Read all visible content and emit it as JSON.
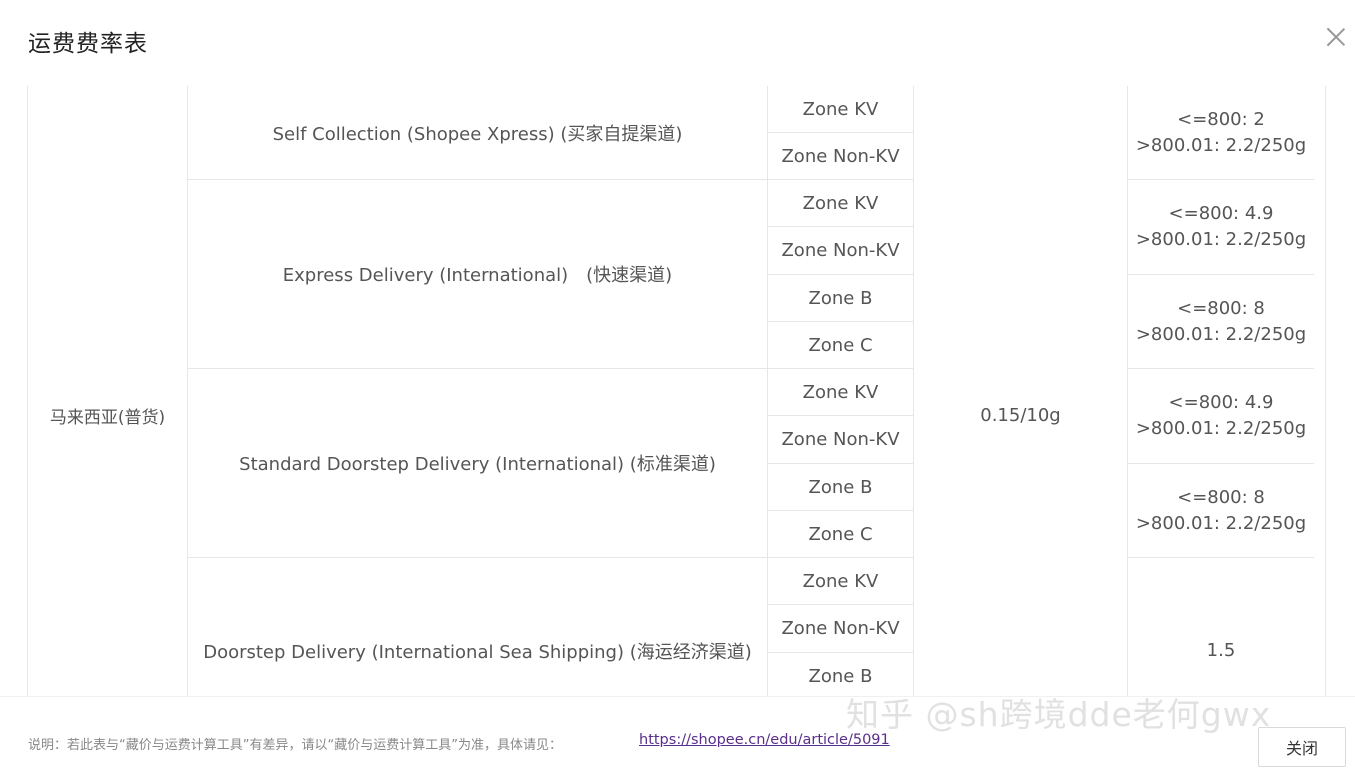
{
  "modal": {
    "title": "运费费率表",
    "close_icon": "close-icon"
  },
  "table": {
    "country": "马来西亚(普货)",
    "weight_rate": "0.15/10g",
    "channels": [
      {
        "name": "Self Collection (Shopee Xpress) (买家自提渠道)",
        "zones": [
          "Zone KV",
          "Zone Non-KV"
        ],
        "rates": [
          [
            "<=800: 2",
            ">800.01: 2.2/250g"
          ]
        ]
      },
      {
        "name": "Express Delivery (International)　(快速渠道)",
        "zones": [
          "Zone KV",
          "Zone Non-KV",
          "Zone B",
          "Zone C"
        ],
        "rates": [
          [
            "<=800: 4.9",
            ">800.01: 2.2/250g"
          ],
          [
            "<=800: 8",
            ">800.01: 2.2/250g"
          ]
        ]
      },
      {
        "name": "Standard Doorstep Delivery (International) (标准渠道)",
        "zones": [
          "Zone KV",
          "Zone Non-KV",
          "Zone B",
          "Zone C"
        ],
        "rates": [
          [
            "<=800: 4.9",
            ">800.01: 2.2/250g"
          ],
          [
            "<=800: 8",
            ">800.01: 2.2/250g"
          ]
        ]
      },
      {
        "name": "Doorstep Delivery (International Sea Shipping) (海运经济渠道)",
        "zones": [
          "Zone KV",
          "Zone Non-KV",
          "Zone B"
        ],
        "rates": [
          [
            "1.5"
          ]
        ]
      }
    ]
  },
  "footer": {
    "note": "说明：若此表与“藏价与运费计算工具”有差异，请以“藏价与运费计算工具”为准，具体请见：",
    "link": "https://shopee.cn/edu/article/5091",
    "close_label": "关闭"
  },
  "watermark": "知乎 @sh跨境dde老何gwx"
}
